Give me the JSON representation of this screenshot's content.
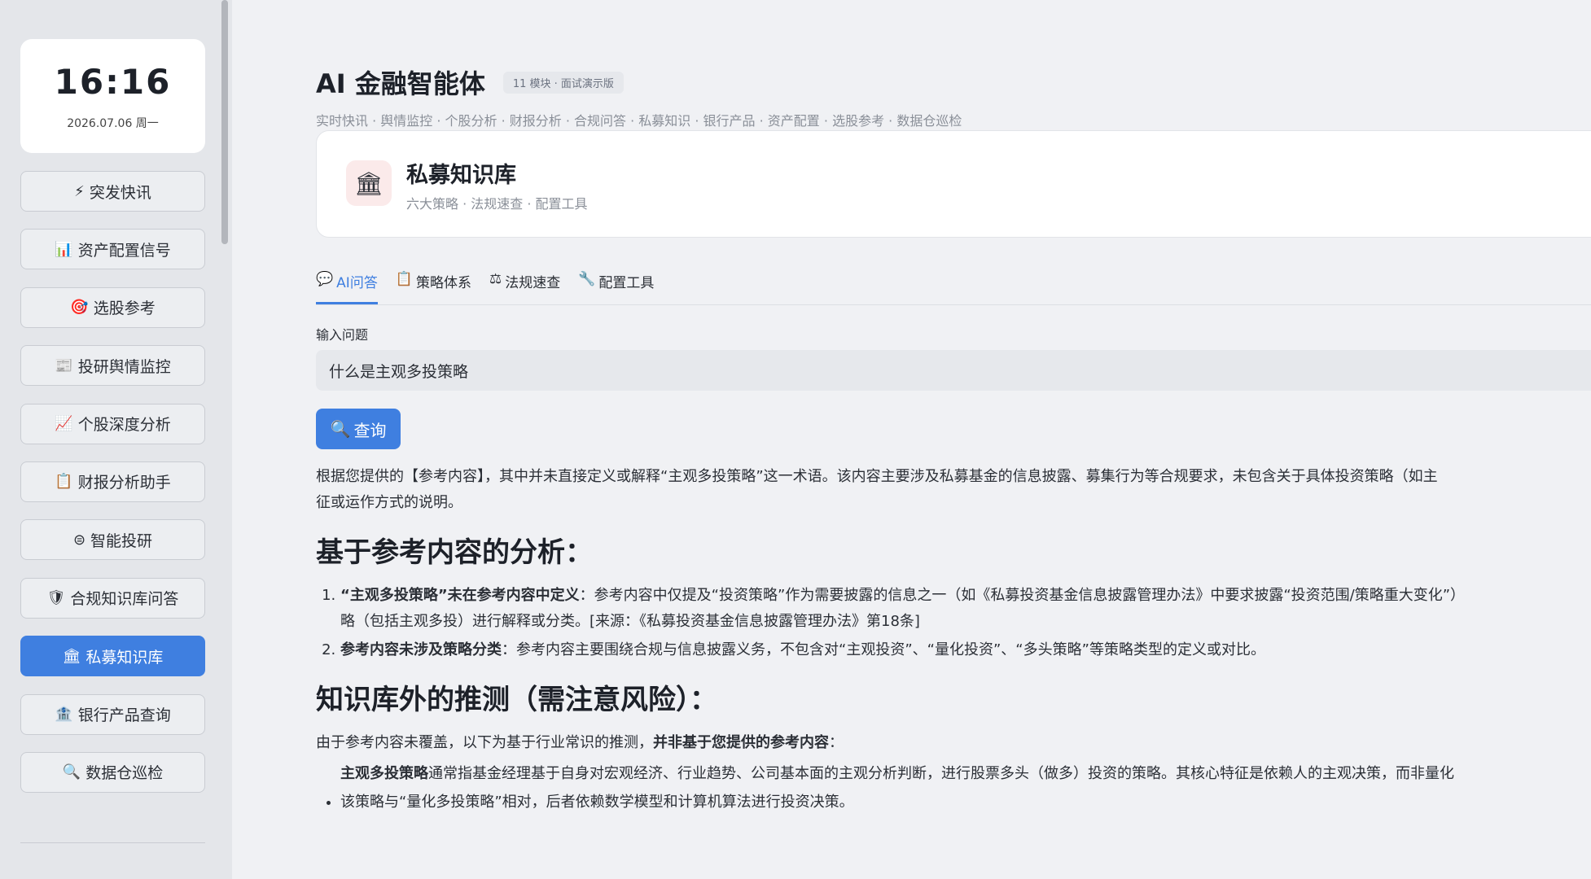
{
  "clock": {
    "time": "16:16",
    "date": "2026.07.06 周一"
  },
  "nav": [
    {
      "icon": "⚡",
      "label": "突发快讯",
      "name": "nav-breaking-news"
    },
    {
      "icon": "📊",
      "label": "资产配置信号",
      "name": "nav-asset-allocation"
    },
    {
      "icon": "🎯",
      "label": "选股参考",
      "name": "nav-stock-picks"
    },
    {
      "icon": "📰",
      "label": "投研舆情监控",
      "name": "nav-sentiment"
    },
    {
      "icon": "📈",
      "label": "个股深度分析",
      "name": "nav-stock-analysis"
    },
    {
      "icon": "📋",
      "label": "财报分析助手",
      "name": "nav-financial-report"
    },
    {
      "icon": "⊜",
      "label": "智能投研",
      "name": "nav-smart-research"
    },
    {
      "icon": "🛡",
      "label": "合规知识库问答",
      "name": "nav-compliance"
    },
    {
      "icon": "🏛",
      "label": "私募知识库",
      "name": "nav-private-fund",
      "active": true
    },
    {
      "icon": "🏦",
      "label": "银行产品查询",
      "name": "nav-bank-products"
    },
    {
      "icon": "🔍",
      "label": "数据仓巡检",
      "name": "nav-data-warehouse"
    }
  ],
  "header": {
    "title": "AI 金融智能体",
    "badge": "11 模块 · 面试演示版",
    "subtitle": "实时快讯 · 舆情监控 · 个股分析 · 财报分析 · 合规问答 · 私募知识 · 银行产品 · 资产配置 · 选股参考 · 数据仓巡检"
  },
  "module": {
    "icon": "🏛",
    "title": "私募知识库",
    "subtitle": "六大策略 · 法规速查 · 配置工具"
  },
  "tabs": [
    {
      "icon": "💬",
      "label": "AI问答",
      "active": true
    },
    {
      "icon": "📋",
      "label": "策略体系"
    },
    {
      "icon": "⚖",
      "label": "法规速查"
    },
    {
      "icon": "🔧",
      "label": "配置工具"
    }
  ],
  "query": {
    "label": "输入问题",
    "value": "什么是主观多投策略",
    "button_icon": "🔍",
    "button_label": "查询"
  },
  "answer": {
    "intro": "根据您提供的【参考内容】，其中并未直接定义或解释“主观多投策略”这一术语。该内容主要涉及私募基金的信息披露、募集行为等合规要求，未包含关于具体投资策略（如主",
    "intro2": "征或运作方式的说明。",
    "h1": "基于参考内容的分析：",
    "points": [
      {
        "bold": "“主观多投策略”未在参考内容中定义",
        "text": "：参考内容中仅提及“投资策略”作为需要披露的信息之一（如《私募投资基金信息披露管理办法》中要求披露“投资范围/策略重大变化”）",
        "text2": "略（包括主观多投）进行解释或分类。[来源：《私募投资基金信息披露管理办法》第18条]"
      },
      {
        "bold": "参考内容未涉及策略分类",
        "text": "：参考内容主要围绕合规与信息披露义务，不包含对“主观投资”、“量化投资”、“多头策略”等策略类型的定义或对比。"
      }
    ],
    "h2": "知识库外的推测（需注意风险）：",
    "note_prefix": "由于参考内容未覆盖，以下为基于行业常识的推测，",
    "note_bold": "并非基于您提供的参考内容",
    "note_suffix": "：",
    "bullets": [
      {
        "bold": "主观多投策略",
        "text": "通常指基金经理基于自身对宏观经济、行业趋势、公司基本面的主观分析判断，进行股票多头（做多）投资的策略。其核心特征是依赖人的主观决策，而非量化"
      },
      {
        "bold": "",
        "text": "该策略与“量化多投策略”相对，后者依赖数学模型和计算机算法进行投资决策。"
      }
    ]
  }
}
